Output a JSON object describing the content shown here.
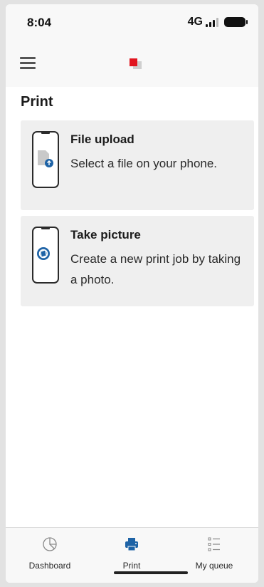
{
  "status_bar": {
    "time": "8:04",
    "network": "4G"
  },
  "app_bar": {
    "menu_icon": "hamburger-menu-icon",
    "logo_icon": "app-logo-icon"
  },
  "page": {
    "title": "Print"
  },
  "cards": [
    {
      "icon": "phone-file-upload-icon",
      "title": "File upload",
      "description": "Select a file on your phone."
    },
    {
      "icon": "phone-camera-icon",
      "title": "Take picture",
      "description": "Create a new print job by taking a photo."
    }
  ],
  "bottom_nav": {
    "active": "Print",
    "accent_color": "#1e63a6",
    "items": [
      {
        "label": "Dashboard",
        "icon": "pie-chart-icon"
      },
      {
        "label": "Print",
        "icon": "printer-icon"
      },
      {
        "label": "My queue",
        "icon": "list-icon"
      }
    ]
  }
}
